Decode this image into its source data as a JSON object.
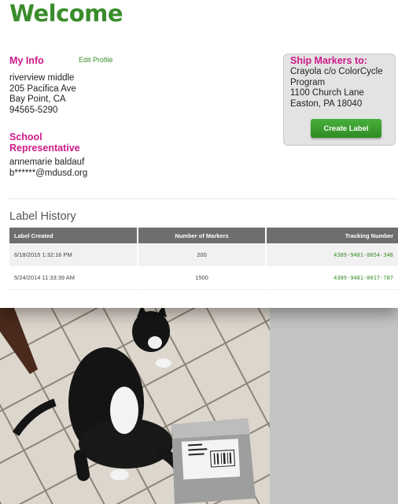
{
  "header": {
    "title": "Welcome"
  },
  "my_info": {
    "heading": "My Info",
    "edit_label": "Edit Profile",
    "lines": [
      "riverview middle",
      "205 Pacifica Ave",
      "Bay Point, CA",
      "94565-5290"
    ]
  },
  "school_rep": {
    "heading_line1": "School",
    "heading_line2": "Representative",
    "name": "annemarie baldauf",
    "email": "b******@mdusd.org"
  },
  "ship_to": {
    "heading": "Ship Markers to:",
    "lines": [
      "Crayola c/o ColorCycle Program",
      "1100 Church Lane",
      "Easton, PA 18040"
    ],
    "button_label": "Create Label"
  },
  "label_history": {
    "title": "Label History",
    "columns": [
      "Label Created",
      "Number of Markers",
      "Tracking Number"
    ],
    "rows": [
      {
        "created": "6/18/2015 1:32:16 PM",
        "markers": "200",
        "tracking": "4389-9481-0054-348"
      },
      {
        "created": "5/24/2014 11:33:39 AM",
        "markers": "1500",
        "tracking": "4389-9481-0017-787"
      }
    ]
  },
  "colors": {
    "brand_green": "#3a8d2b",
    "accent_pink": "#cc1b88"
  }
}
